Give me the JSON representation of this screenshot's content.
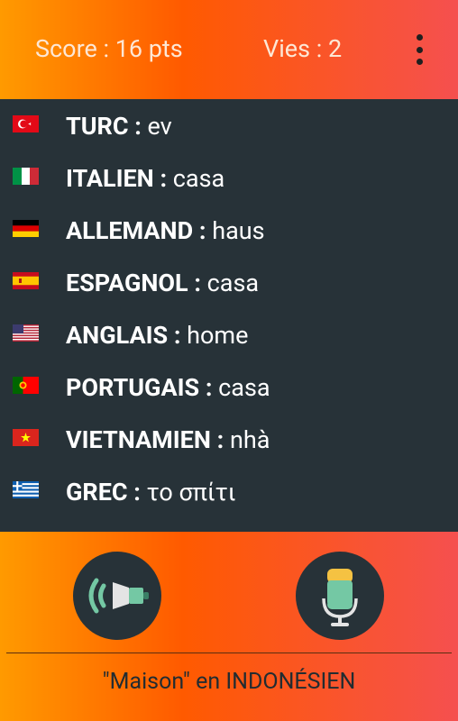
{
  "header": {
    "score": "Score : 16 pts",
    "lives": "Vies : 2"
  },
  "translations": [
    {
      "flag": "turkey-flag-icon",
      "language": "TURC",
      "separator": " : ",
      "word": "ev"
    },
    {
      "flag": "italy-flag-icon",
      "language": "ITALIEN",
      "separator": " : ",
      "word": "casa"
    },
    {
      "flag": "germany-flag-icon",
      "language": "ALLEMAND",
      "separator": " : ",
      "word": "haus"
    },
    {
      "flag": "spain-flag-icon",
      "language": "ESPAGNOL",
      "separator": " : ",
      "word": "casa"
    },
    {
      "flag": "usa-flag-icon",
      "language": "ANGLAIS",
      "separator": " : ",
      "word": "home"
    },
    {
      "flag": "portugal-flag-icon",
      "language": "PORTUGAIS",
      "separator": " : ",
      "word": "casa"
    },
    {
      "flag": "vietnam-flag-icon",
      "language": "VIETNAMIEN",
      "separator": " : ",
      "word": "nhà"
    },
    {
      "flag": "greece-flag-icon",
      "language": "GREC",
      "separator": " : ",
      "word": "το σπίτι"
    }
  ],
  "controls": {
    "speaker_icon": "speaker-icon",
    "mic_icon": "microphone-icon"
  },
  "prompt": "\"Maison\" en INDONÉSIEN",
  "colors": {
    "gradient_start": "#ff9a00",
    "gradient_mid": "#ff5a00",
    "gradient_end": "#f5504f",
    "list_bg": "#273238",
    "accent_teal": "#74c8a4",
    "mic_yellow": "#f5c242"
  }
}
